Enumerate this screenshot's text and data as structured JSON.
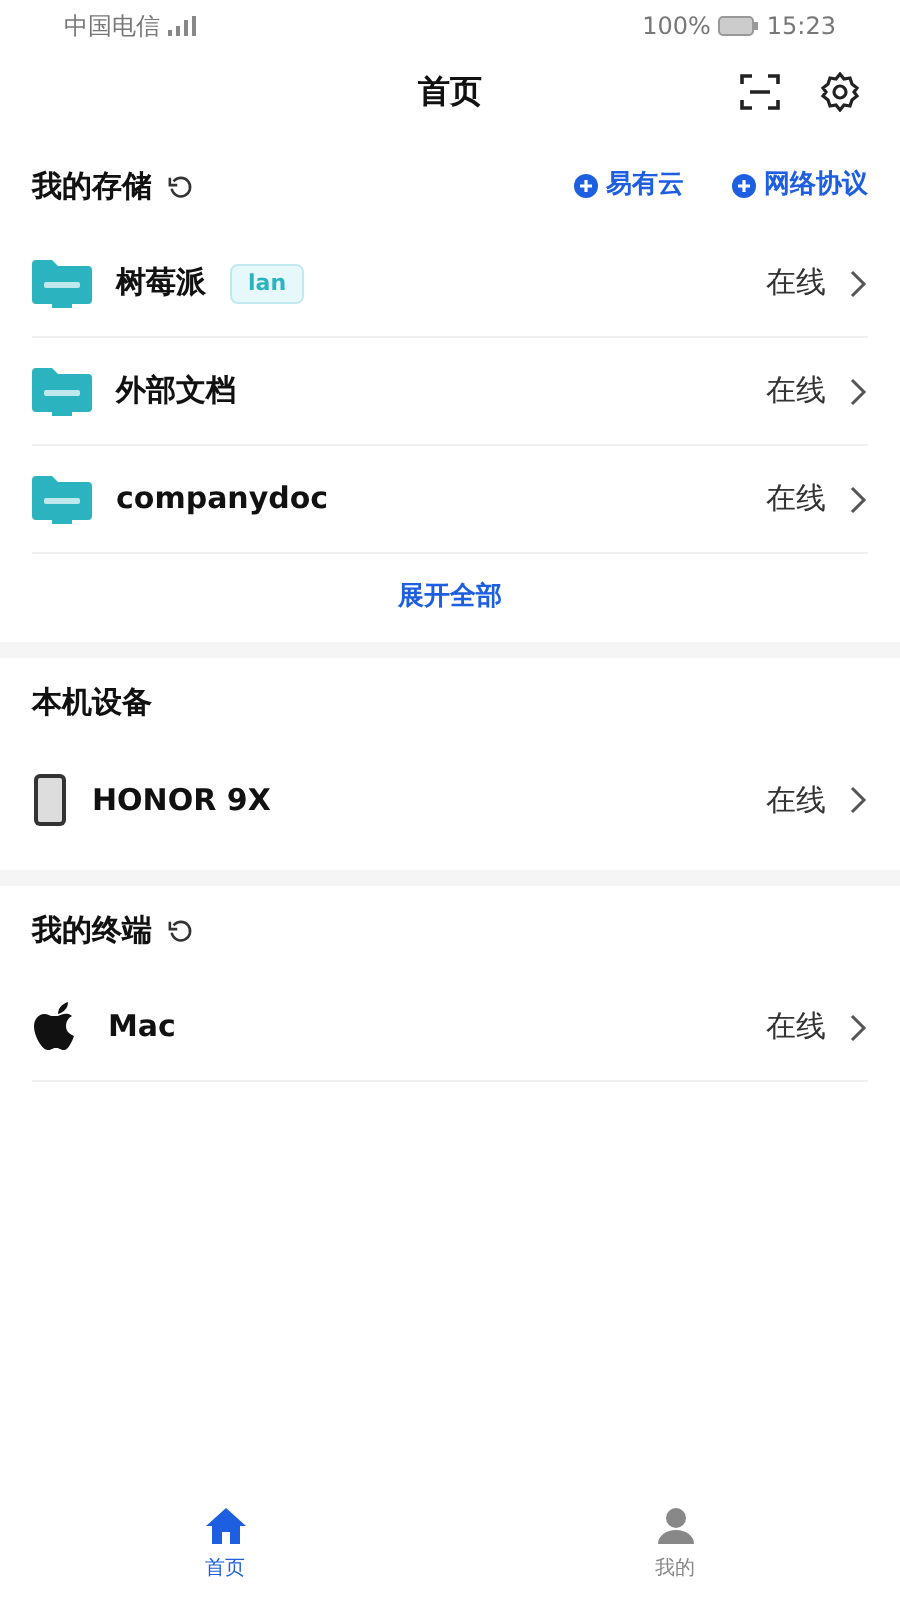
{
  "status_bar": {
    "carrier": "中国电信",
    "battery": "100%",
    "time": "15:23"
  },
  "header": {
    "title": "首页"
  },
  "storage": {
    "title": "我的存储",
    "actions": [
      "易有云",
      "网络协议"
    ],
    "items": [
      {
        "name": "树莓派",
        "tag": "lan",
        "status": "在线"
      },
      {
        "name": "外部文档",
        "status": "在线"
      },
      {
        "name": "companydoc",
        "status": "在线"
      }
    ],
    "expand": "展开全部"
  },
  "local": {
    "title": "本机设备",
    "items": [
      {
        "kind": "phone",
        "name": "HONOR 9X",
        "status": "在线"
      }
    ]
  },
  "terminals": {
    "title": "我的终端",
    "items": [
      {
        "kind": "apple",
        "name": "Mac",
        "status": "在线"
      }
    ]
  },
  "tabs": [
    {
      "kind": "home",
      "label": "首页",
      "selected": true
    },
    {
      "kind": "person",
      "label": "我的",
      "selected": false
    }
  ]
}
